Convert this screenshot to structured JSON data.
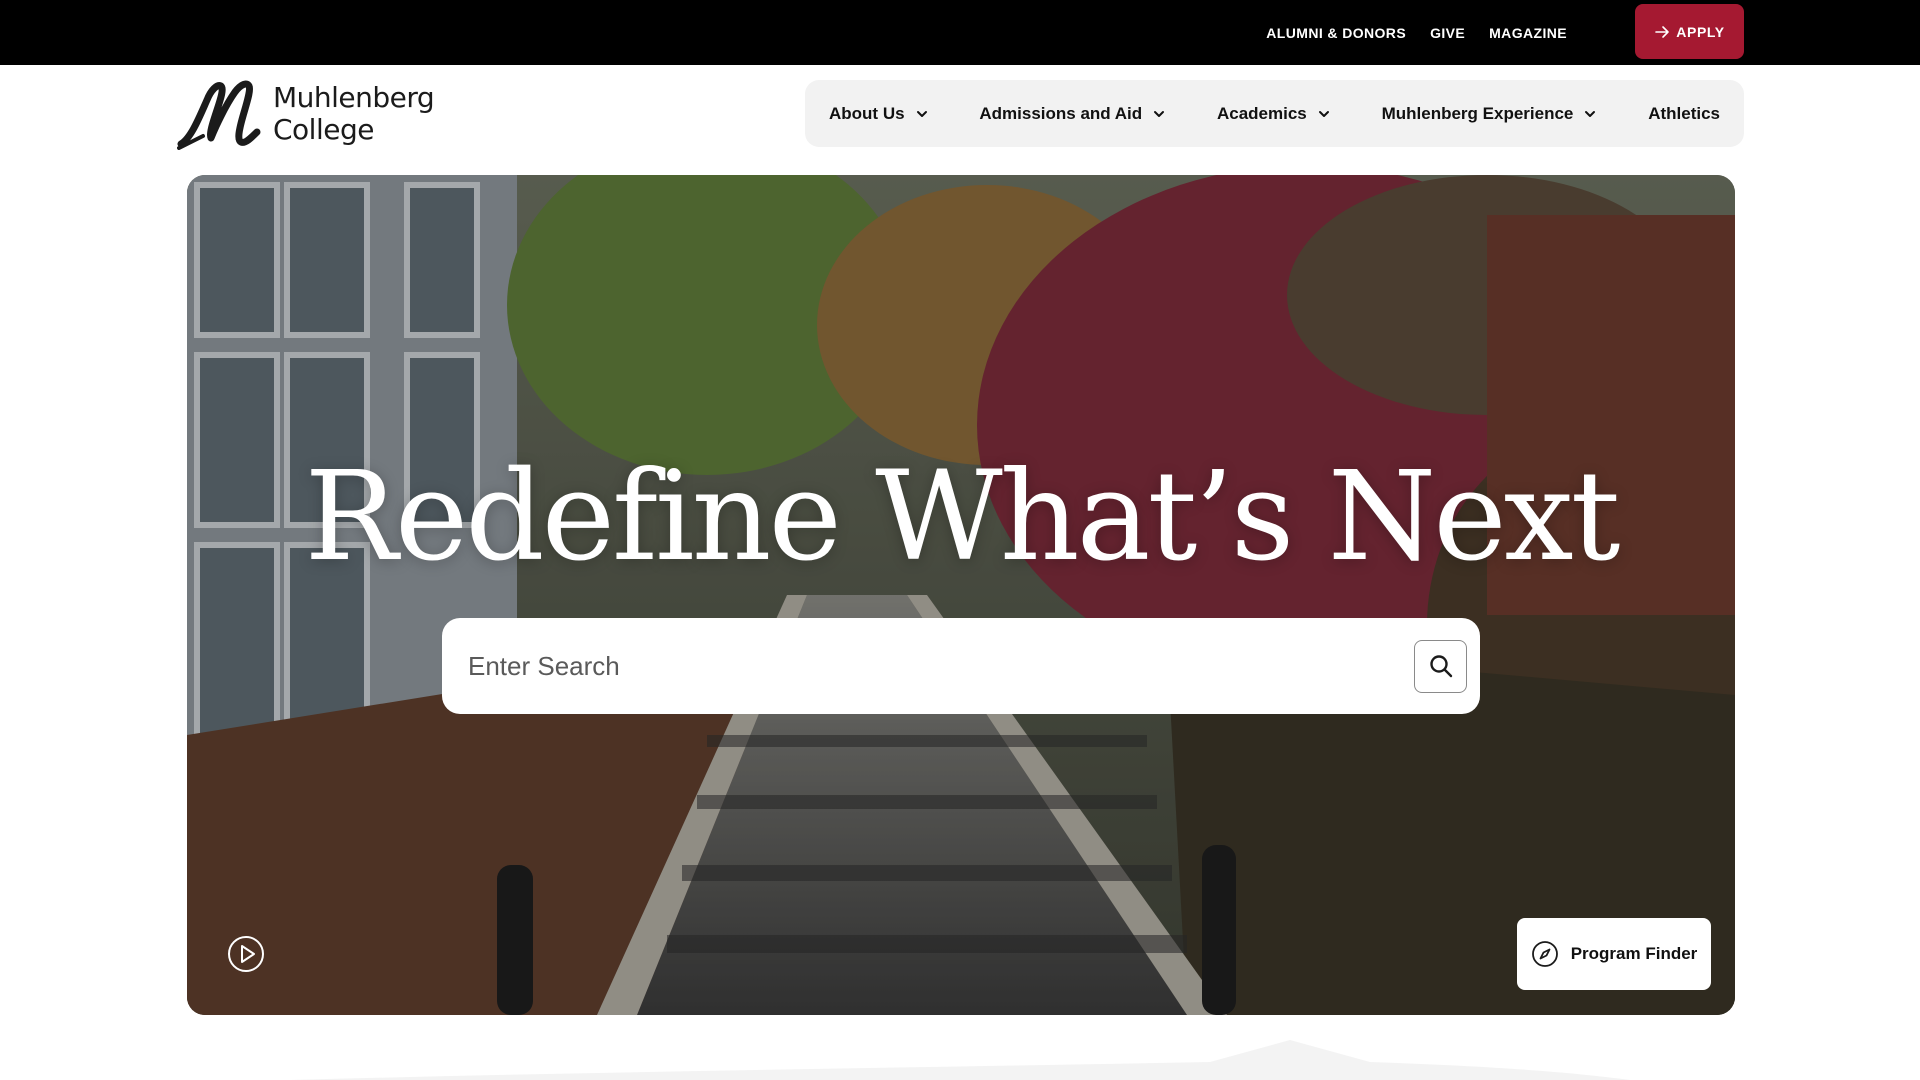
{
  "utility_nav": {
    "links": [
      {
        "label": "ALUMNI & DONORS"
      },
      {
        "label": "GIVE"
      },
      {
        "label": "MAGAZINE"
      }
    ],
    "apply_label": "APPLY"
  },
  "logo": {
    "line1": "Muhlenberg",
    "line2": "College"
  },
  "main_nav": {
    "items": [
      {
        "label": "About Us",
        "has_dropdown": true
      },
      {
        "label": "Admissions and Aid",
        "has_dropdown": true
      },
      {
        "label": "Academics",
        "has_dropdown": true
      },
      {
        "label": "Muhlenberg Experience",
        "has_dropdown": true
      },
      {
        "label": "Athletics",
        "has_dropdown": false
      }
    ]
  },
  "hero": {
    "title": "Redefine What’s Next",
    "search_placeholder": "Enter Search",
    "program_finder_label": "Program Finder"
  },
  "colors": {
    "brand_red": "#a51931",
    "utility_bar": "#000000",
    "nav_background": "#f2f2f2"
  }
}
